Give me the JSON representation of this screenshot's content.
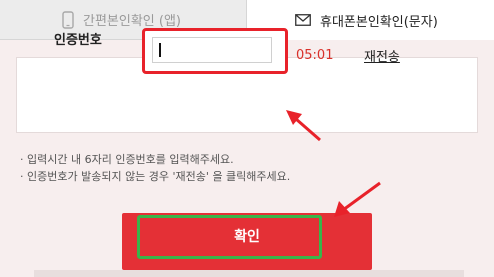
{
  "tabs": [
    {
      "label": "간편본인확인 (앱)",
      "icon": "phone-icon",
      "active": false
    },
    {
      "label": "휴대폰본인확인(문자)",
      "icon": "envelope-icon",
      "active": true
    }
  ],
  "verification": {
    "label": "인증번호",
    "value": "",
    "timer": "05:01",
    "resend_label": "재전송"
  },
  "notes": [
    "· 입력시간 내 6자리 인증번호를 입력해주세요.",
    "· 인증번호가 발송되지 않는 경우 '재전송' 을 클릭해주세요."
  ],
  "confirm_label": "확인",
  "colors": {
    "accent": "#e43036",
    "highlight_red": "#e8222a",
    "highlight_green": "#39b54a",
    "background": "#f7eeee"
  }
}
